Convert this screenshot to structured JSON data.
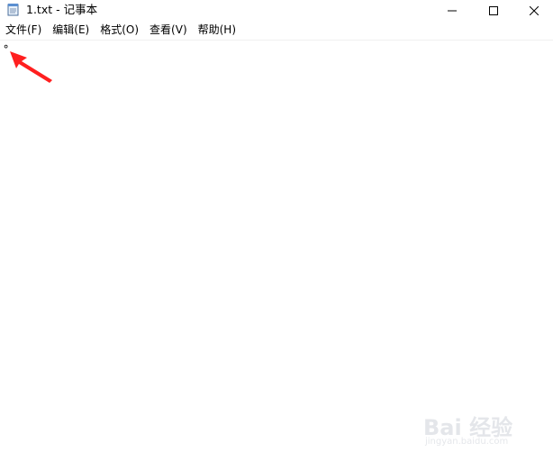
{
  "window": {
    "title": "1.txt - 记事本",
    "icon": "notepad-icon"
  },
  "controls": {
    "minimize_icon": "minimize-icon",
    "maximize_icon": "maximize-icon",
    "close_icon": "close-icon"
  },
  "menu": {
    "items": [
      {
        "label": "文件(F)"
      },
      {
        "label": "编辑(E)"
      },
      {
        "label": "格式(O)"
      },
      {
        "label": "查看(V)"
      },
      {
        "label": "帮助(H)"
      }
    ]
  },
  "editor": {
    "content": "°"
  },
  "annotation": {
    "arrow_color": "#ff1f1f"
  },
  "watermark": {
    "brand": "Bai 经验",
    "url": "jingyan.baidu.com"
  }
}
